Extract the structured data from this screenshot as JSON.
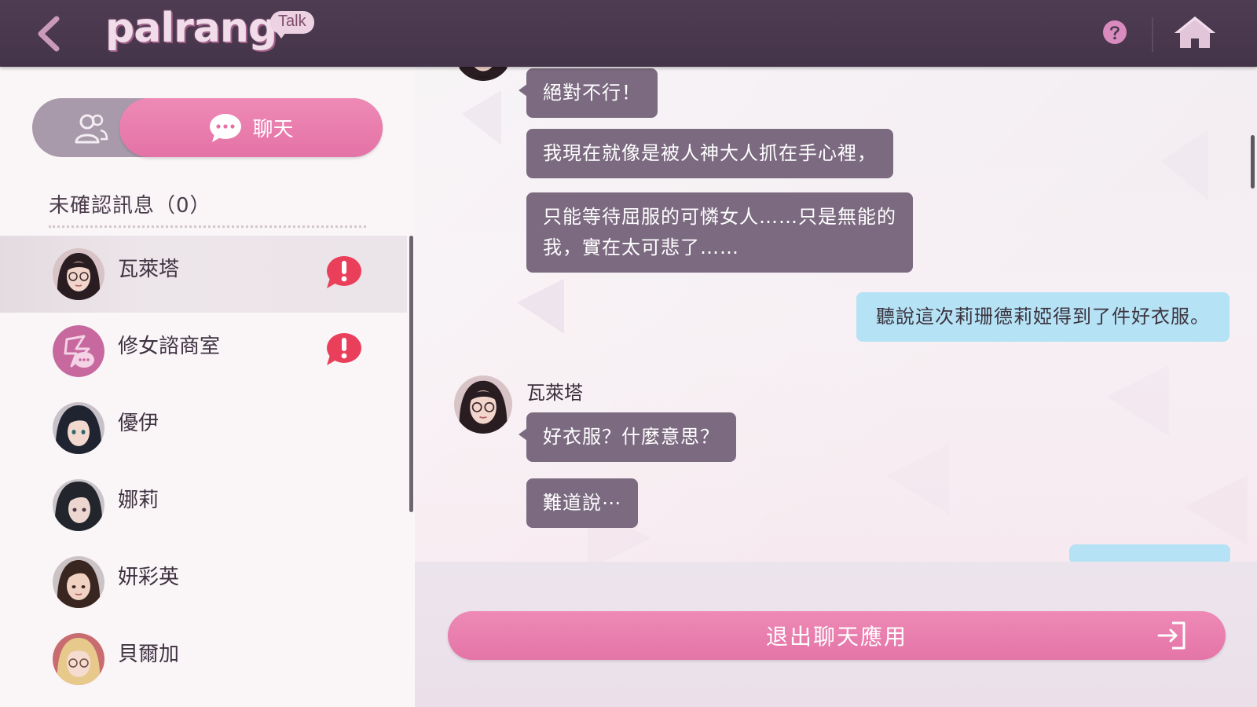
{
  "header": {
    "logo_text": "palrang",
    "logo_badge": "Talk",
    "back_icon": "chevron-left-icon",
    "help_icon": "question-icon",
    "home_icon": "home-icon",
    "colors": {
      "bar": "#4a3a4e",
      "accent": "#e9699e"
    }
  },
  "sidebar": {
    "tabs": {
      "contacts_icon": "users-icon",
      "chat_icon": "chat-bubble-icon",
      "chat_label": "聊天"
    },
    "unread_label": "未確認訊息（0）",
    "contacts": [
      {
        "name": "瓦萊塔",
        "avatar": "avatar-valletta",
        "unread_alert": true,
        "active": true
      },
      {
        "name": "修女諮商室",
        "avatar": "avatar-counseling",
        "unread_alert": true,
        "active": false
      },
      {
        "name": "優伊",
        "avatar": "avatar-yui",
        "unread_alert": false,
        "active": false
      },
      {
        "name": "娜莉",
        "avatar": "avatar-nari",
        "unread_alert": false,
        "active": false
      },
      {
        "name": "妍彩英",
        "avatar": "avatar-yeon",
        "unread_alert": false,
        "active": false
      },
      {
        "name": "貝爾加",
        "avatar": "avatar-belga",
        "unread_alert": false,
        "active": false
      }
    ]
  },
  "chat": {
    "messages": [
      {
        "from": "瓦萊塔",
        "side": "in",
        "text": "絕對不行！"
      },
      {
        "from": "瓦萊塔",
        "side": "in",
        "text": "我現在就像是被人神大人抓在手心裡，"
      },
      {
        "from": "瓦萊塔",
        "side": "in",
        "lines": [
          "只能等待屈服的可憐女人……只是無能的",
          "我，實在太可悲了……"
        ]
      },
      {
        "from": "me",
        "side": "out",
        "text": "聽說這次莉珊德莉婭得到了件好衣服。"
      },
      {
        "from": "瓦萊塔",
        "side": "in",
        "sender_label": "瓦萊塔",
        "text": "好衣服？什麼意思？"
      },
      {
        "from": "瓦萊塔",
        "side": "in",
        "text": "難道說⋯"
      },
      {
        "from": "me",
        "side": "out",
        "partial": true
      }
    ],
    "exit_button_label": "退出聊天應用",
    "exit_icon": "exit-door-icon"
  }
}
